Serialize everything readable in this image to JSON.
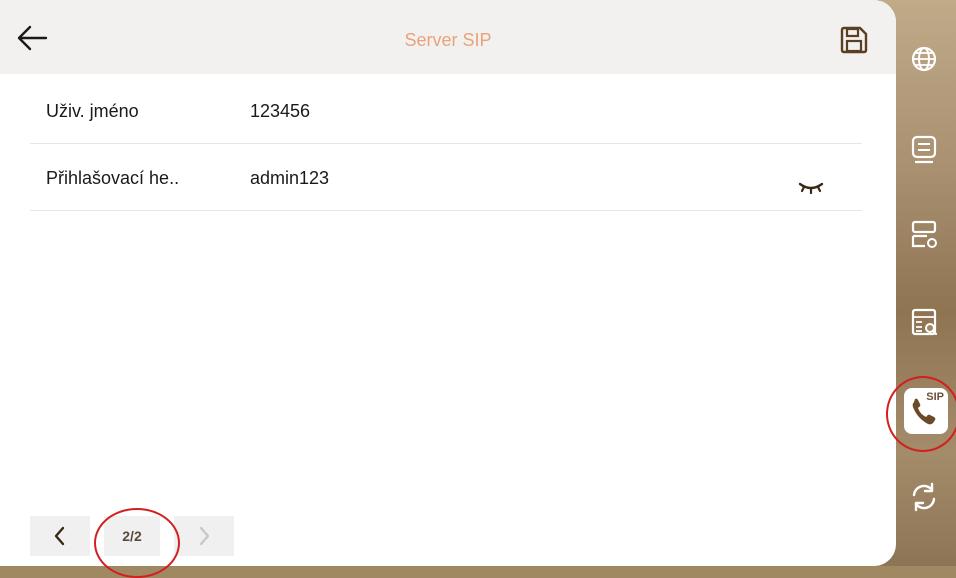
{
  "header": {
    "title": "Server SIP"
  },
  "rows": [
    {
      "label": "Uživ. jméno",
      "value": "123456"
    },
    {
      "label": "Přihlašovací he..",
      "value": "admin123"
    }
  ],
  "pager": {
    "indicator": "2/2"
  },
  "sidebar": {
    "items": [
      {
        "icon": "globe-icon"
      },
      {
        "icon": "list-icon"
      },
      {
        "icon": "server-settings-icon"
      },
      {
        "icon": "server-search-icon"
      },
      {
        "icon": "sip-phone-icon",
        "label": "SIP",
        "active": true
      },
      {
        "icon": "refresh-icon"
      }
    ]
  },
  "colors": {
    "accent": "#e8a37a",
    "highlight": "#d21f1f",
    "icon": "#5a3f24"
  }
}
